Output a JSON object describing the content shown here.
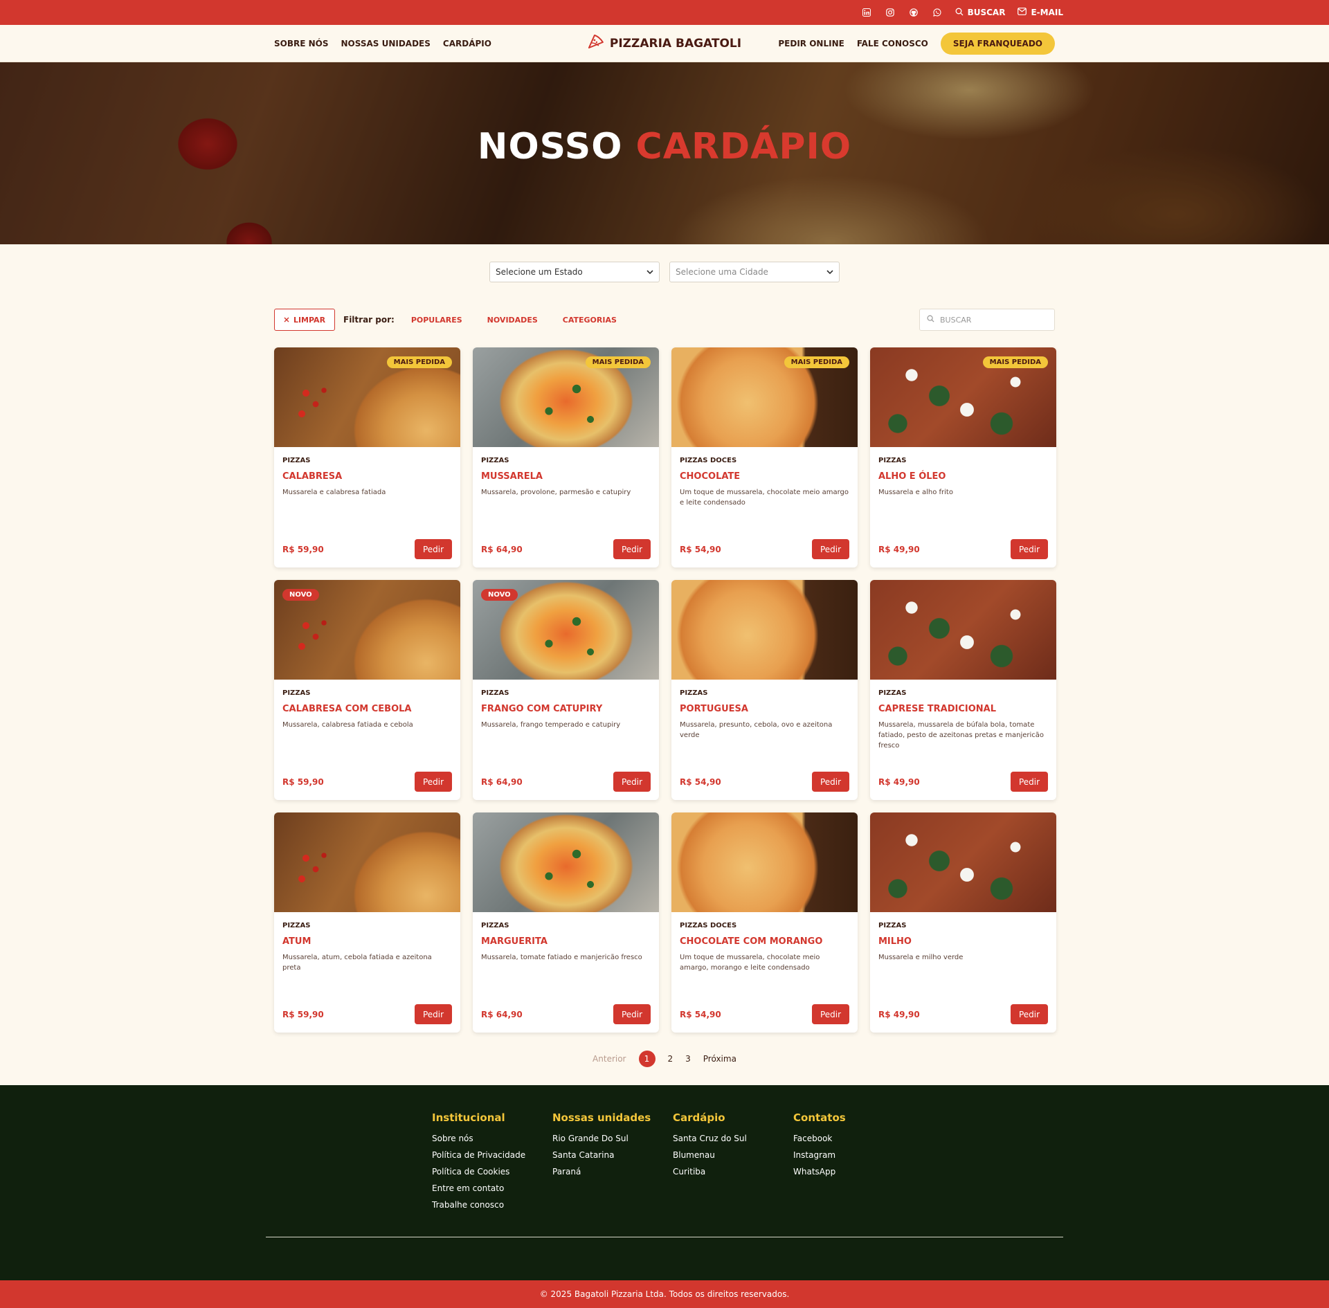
{
  "topbar": {
    "icons": [
      "linkedin-icon",
      "instagram-icon",
      "github-icon",
      "whatsapp-icon"
    ],
    "search_label": "BUSCAR",
    "email_label": "E-MAIL"
  },
  "nav": {
    "left": [
      "SOBRE NÓS",
      "NOSSAS UNIDADES",
      "CARDÁPIO"
    ],
    "brand": "PIZZARIA BAGATOLI",
    "right": [
      "PEDIR ONLINE",
      "FALE CONOSCO"
    ],
    "cta": "SEJA FRANQUEADO"
  },
  "hero": {
    "title_white": "NOSSO",
    "title_red": "CARDÁPIO"
  },
  "selectors": {
    "state": "Selecione um Estado",
    "city": "Selecione uma Cidade"
  },
  "filters": {
    "clear": "LIMPAR",
    "label": "Filtrar por:",
    "options": [
      "POPULARES",
      "NOVIDADES",
      "CATEGORIAS"
    ],
    "search_placeholder": "BUSCAR"
  },
  "products": [
    {
      "badge": "MAIS PEDIDA",
      "category": "PIZZAS",
      "name": "CALABRESA",
      "description": "Mussarela e calabresa fatiada",
      "price": "R$ 59,90",
      "button": "Pedir"
    },
    {
      "badge": "MAIS PEDIDA",
      "category": "PIZZAS",
      "name": "MUSSARELA",
      "description": "Mussarela, provolone, parmesão e catupiry",
      "price": "R$ 64,90",
      "button": "Pedir"
    },
    {
      "badge": "MAIS PEDIDA",
      "category": "PIZZAS DOCES",
      "name": "CHOCOLATE",
      "description": "Um toque de mussarela, chocolate meio amargo e leite condensado",
      "price": "R$ 54,90",
      "button": "Pedir"
    },
    {
      "badge": "MAIS PEDIDA",
      "category": "PIZZAS",
      "name": "ALHO E ÓLEO",
      "description": "Mussarela e alho frito",
      "price": "R$ 49,90",
      "button": "Pedir"
    },
    {
      "badge": "NOVO",
      "category": "PIZZAS",
      "name": "CALABRESA COM CEBOLA",
      "description": "Mussarela, calabresa fatiada e cebola",
      "price": "R$ 59,90",
      "button": "Pedir"
    },
    {
      "badge": "NOVO",
      "category": "PIZZAS",
      "name": "FRANGO COM CATUPIRY",
      "description": "Mussarela, frango temperado e catupiry",
      "price": "R$ 64,90",
      "button": "Pedir"
    },
    {
      "badge": "",
      "category": "PIZZAS",
      "name": "PORTUGUESA",
      "description": "Mussarela, presunto, cebola, ovo e azeitona verde",
      "price": "R$ 54,90",
      "button": "Pedir"
    },
    {
      "badge": "",
      "category": "PIZZAS",
      "name": "CAPRESE TRADICIONAL",
      "description": "Mussarela, mussarela de búfala bola, tomate fatiado, pesto de azeitonas pretas e manjericão fresco",
      "price": "R$ 49,90",
      "button": "Pedir"
    },
    {
      "badge": "",
      "category": "PIZZAS",
      "name": "ATUM",
      "description": "Mussarela, atum, cebola fatiada e azeitona preta",
      "price": "R$ 59,90",
      "button": "Pedir"
    },
    {
      "badge": "",
      "category": "PIZZAS",
      "name": "MARGUERITA",
      "description": "Mussarela, tomate fatiado e manjericão fresco",
      "price": "R$ 64,90",
      "button": "Pedir"
    },
    {
      "badge": "",
      "category": "PIZZAS DOCES",
      "name": "CHOCOLATE COM MORANGO",
      "description": "Um toque de mussarela, chocolate meio amargo, morango e leite condensado",
      "price": "R$ 54,90",
      "button": "Pedir"
    },
    {
      "badge": "",
      "category": "PIZZAS",
      "name": "MILHO",
      "description": "Mussarela e milho verde",
      "price": "R$ 49,90",
      "button": "Pedir"
    }
  ],
  "pagination": {
    "previous": "Anterior",
    "pages": [
      "1",
      "2",
      "3"
    ],
    "current": "1",
    "next": "Próxima"
  },
  "footer": {
    "columns": [
      {
        "title": "Institucional",
        "links": [
          "Sobre nós",
          "Política de Privacidade",
          "Política de Cookies",
          "Entre em contato",
          "Trabalhe conosco"
        ]
      },
      {
        "title": "Nossas unidades",
        "links": [
          "Rio Grande Do Sul",
          "Santa Catarina",
          "Paraná"
        ]
      },
      {
        "title": "Cardápio",
        "links": [
          "Santa Cruz do Sul",
          "Blumenau",
          "Curitiba"
        ]
      },
      {
        "title": "Contatos",
        "links": [
          "Facebook",
          "Instagram",
          "WhatsApp"
        ]
      }
    ],
    "copyright": "© 2025 Bagatoli Pizzaria Ltda. Todos os direitos reservados."
  },
  "colors": {
    "primary_red": "#d2372e",
    "accent_yellow": "#f3c63a",
    "page_bg": "#fdf8ee",
    "footer_bg": "#10200d"
  }
}
